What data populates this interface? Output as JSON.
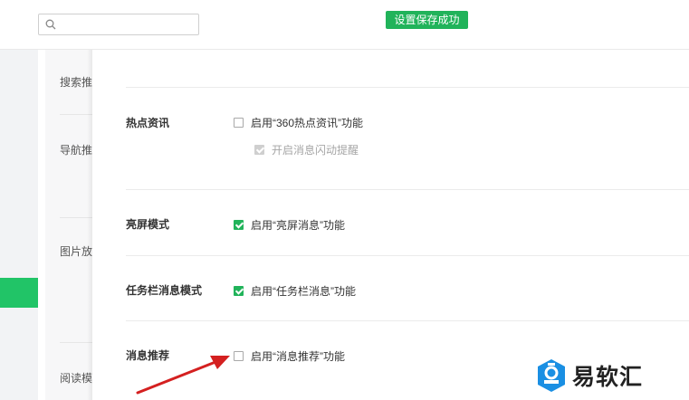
{
  "search": {
    "placeholder": "",
    "icon": "search-icon"
  },
  "toast": {
    "text": "设置保存成功",
    "color": "#21b35a"
  },
  "nav": {
    "items": [
      {
        "label": "搜索推"
      },
      {
        "label": "导航推"
      },
      {
        "label": "图片放"
      },
      {
        "label": "阅读模"
      }
    ]
  },
  "sections": [
    {
      "title": "热点资讯",
      "options": [
        {
          "label": "启用“360热点资讯”功能",
          "checked": false,
          "disabled": false
        },
        {
          "label": "开启消息闪动提醒",
          "checked": true,
          "disabled": true
        }
      ]
    },
    {
      "title": "亮屏模式",
      "options": [
        {
          "label": "启用“亮屏消息”功能",
          "checked": true,
          "disabled": false
        }
      ]
    },
    {
      "title": "任务栏消息模式",
      "options": [
        {
          "label": "启用“任务栏消息”功能",
          "checked": true,
          "disabled": false
        }
      ]
    },
    {
      "title": "消息推荐",
      "options": [
        {
          "label": "启用“消息推荐”功能",
          "checked": false,
          "disabled": false
        }
      ]
    }
  ],
  "watermark": {
    "text": "易软汇",
    "icon": "logo-icon",
    "color": "#1a8fe3"
  },
  "accent": "#21c467"
}
